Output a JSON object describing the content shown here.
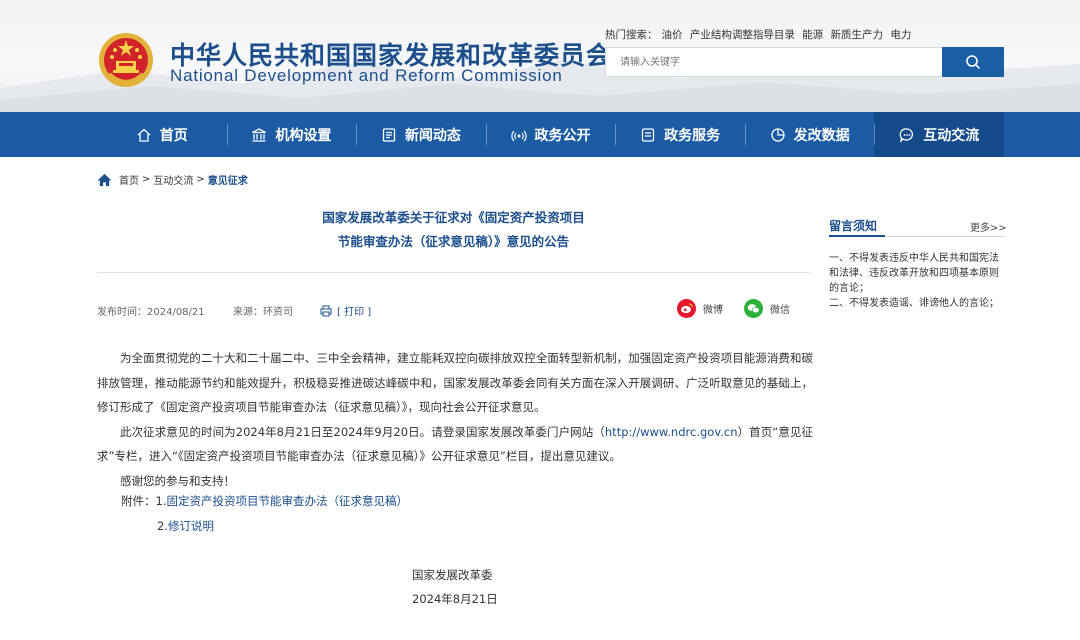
{
  "header": {
    "title_cn": "中华人民共和国国家发展和改革委员会",
    "title_en": "National Development and Reform Commission",
    "hot_label": "热门搜索：",
    "hot_keywords": [
      "油价",
      "产业结构调整指导目录",
      "能源",
      "新质生产力",
      "电力"
    ],
    "search_placeholder": "请输入关键字"
  },
  "nav": {
    "items": [
      {
        "label": "首页",
        "icon": "home-icon"
      },
      {
        "label": "机构设置",
        "icon": "institution-icon"
      },
      {
        "label": "新闻动态",
        "icon": "news-icon"
      },
      {
        "label": "政务公开",
        "icon": "broadcast-icon"
      },
      {
        "label": "政务服务",
        "icon": "service-icon"
      },
      {
        "label": "发改数据",
        "icon": "data-icon"
      },
      {
        "label": "互动交流",
        "icon": "chat-icon"
      }
    ],
    "active_index": 6
  },
  "breadcrumb": {
    "items": [
      "首页",
      "互动交流",
      "意见征求"
    ],
    "separator": ">"
  },
  "article": {
    "title_line1": "国家发展改革委关于征求对《固定资产投资项目",
    "title_line2": "节能审查办法（征求意见稿）》意见的公告",
    "publish_time": "发布时间：2024/08/21",
    "source": "来源：环资司",
    "print_label": "[ 打印 ]",
    "share_weibo": "微博",
    "share_wechat": "微信",
    "para1": "为全面贯彻党的二十大和二十届二中、三中全会精神，建立能耗双控向碳排放双控全面转型新机制，加强固定资产投资项目能源消费和碳排放管理，推动能源节约和能效提升，积极稳妥推进碳达峰碳中和，国家发展改革委会同有关方面在深入开展调研、广泛听取意见的基础上，修订形成了《固定资产投资项目节能审查办法（征求意见稿）》，现向社会公开征求意见。",
    "para2_before": "此次征求意见的时间为2024年8月21日至2024年9月20日。请登录国家发展改革委门户网站（",
    "para2_link": "http://www.ndrc.gov.cn",
    "para2_after": "）首页“意见征求”专栏，进入“《固定资产投资项目节能审查办法（征求意见稿）》公开征求意见”栏目，提出意见建议。",
    "para3": "感谢您的参与和支持！",
    "attachment_label": "附件：",
    "attachment1_num": "1.",
    "attachment1": "固定资产投资项目节能审查办法（征求意见稿）",
    "attachment2_num": "2.",
    "attachment2": "修订说明",
    "signature": "国家发展改革委",
    "date": "2024年8月21日"
  },
  "sidebar": {
    "title": "留言须知",
    "more": "更多>>",
    "rule1": "一、不得发表违反中华人民共和国宪法和法律、违反改革开放和四项基本原则的言论；",
    "rule2": "二、不得发表造谣、诽谤他人的言论；"
  },
  "colors": {
    "brand_blue": "#1c4f8c",
    "nav_blue": "#1b5ba3",
    "weibo_red": "#e6162d",
    "wechat_green": "#2bb13a"
  }
}
